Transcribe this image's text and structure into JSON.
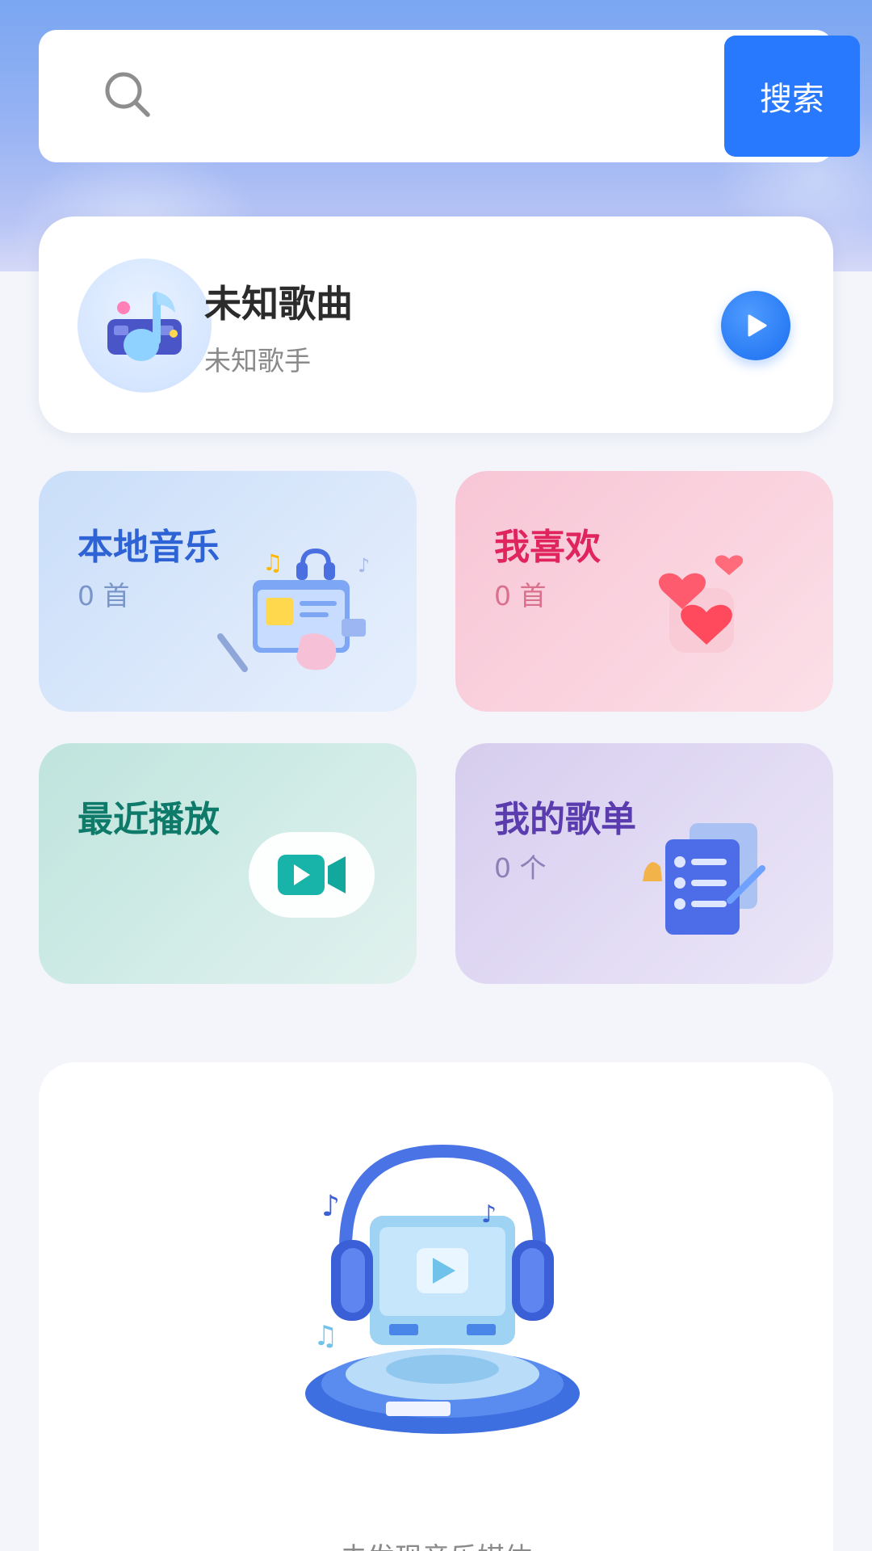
{
  "search": {
    "placeholder": "",
    "button_label": "搜索"
  },
  "now_playing": {
    "title": "未知歌曲",
    "artist": "未知歌手"
  },
  "tiles": [
    {
      "title": "本地音乐",
      "count": "0 首"
    },
    {
      "title": "我喜欢",
      "count": "0 首"
    },
    {
      "title": "最近播放",
      "count": ""
    },
    {
      "title": "我的歌单",
      "count": "0 个"
    }
  ],
  "empty_state": {
    "message": "未发现音乐媒体"
  },
  "colors": {
    "accent": "#2979ff",
    "local": "#2e63d6",
    "favorite": "#e0245e",
    "recent": "#0e7a6a",
    "playlist": "#5a3cae"
  }
}
